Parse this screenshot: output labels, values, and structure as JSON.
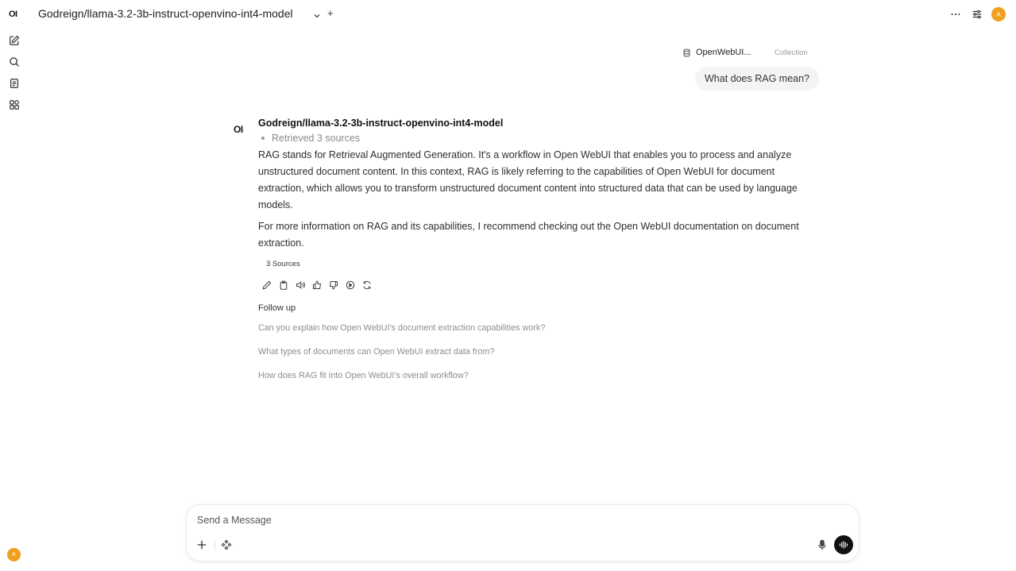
{
  "sidebar": {
    "logo": "OI",
    "items": [
      {
        "icon": "new-chat-icon"
      },
      {
        "icon": "search-icon"
      },
      {
        "icon": "notes-icon"
      },
      {
        "icon": "workspace-icon"
      }
    ],
    "user_initial": "A"
  },
  "header": {
    "model_name": "Godreign/llama-3.2-3b-instruct-openvino-int4-model",
    "add_label": "+",
    "icons": [
      "more-icon",
      "controls-icon"
    ],
    "user_initial": "A"
  },
  "user_message": {
    "source_name": "OpenWebUI...",
    "source_type": "Collection",
    "text": "What does RAG mean?"
  },
  "assistant": {
    "logo": "OI",
    "model_name": "Godreign/llama-3.2-3b-instruct-openvino-int4-model",
    "status": "Retrieved 3 sources",
    "paragraphs": [
      "RAG stands for Retrieval Augmented Generation. It's a workflow in Open WebUI that enables you to process and analyze unstructured document content. In this context, RAG is likely referring to the capabilities of Open WebUI for document extraction, which allows you to transform unstructured document content into structured data that can be used by language models.",
      "For more information on RAG and its capabilities, I recommend checking out the Open WebUI documentation on document extraction."
    ],
    "sources_label": "3 Sources",
    "actions": [
      "edit-icon",
      "copy-icon",
      "read-aloud-icon",
      "thumbs-up-icon",
      "thumbs-down-icon",
      "continue-icon",
      "regenerate-icon"
    ]
  },
  "follow_up": {
    "title": "Follow up",
    "items": [
      "Can you explain how Open WebUI's document extraction capabilities work?",
      "What types of documents can Open WebUI extract data from?",
      "How does RAG fit into Open WebUI's overall workflow?"
    ]
  },
  "composer": {
    "placeholder": "Send a Message"
  }
}
